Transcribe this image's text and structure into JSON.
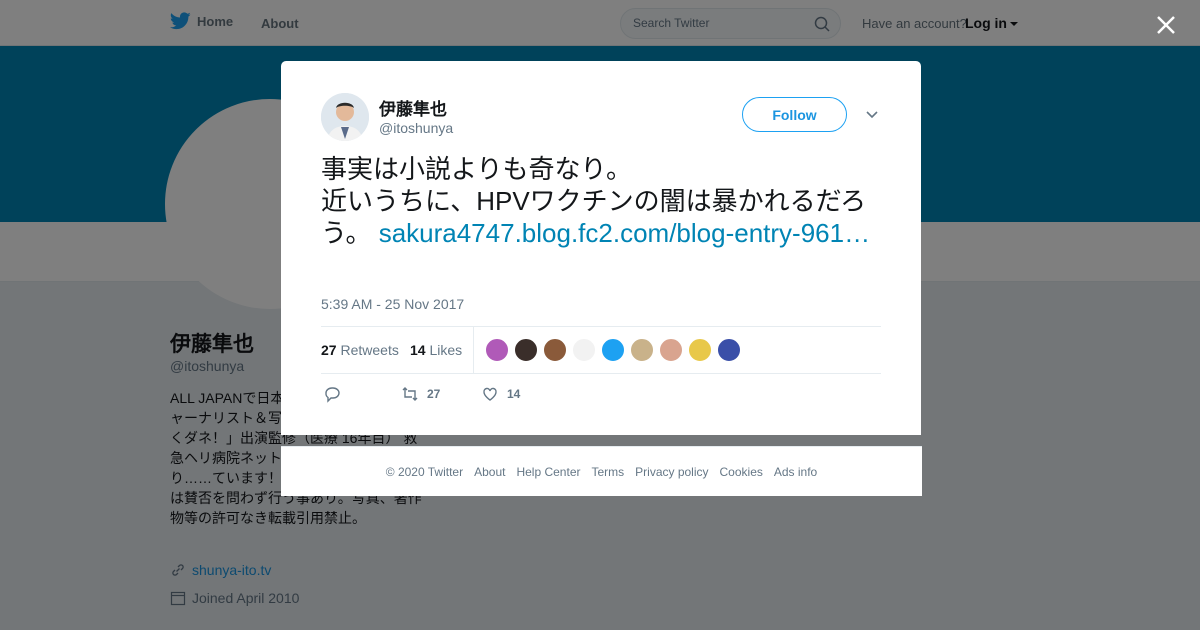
{
  "topnav": {
    "home_label": "Home",
    "about_label": "About",
    "search_placeholder": "Search Twitter",
    "account_prompt": "Have an account?",
    "login_label": "Log in"
  },
  "background_profile": {
    "name": "伊藤隼也",
    "handle": "@itoshunya",
    "bio": "ALL JAPANで日本の医療を考える医療ジャーナリスト＆写真家。フジテレビ「とくダネ！」出演監修（医療 16年目） 救急ヘリ病院ネットワーク（HEM-Net）より……ています！※ 発言は私的呟きでRTは賛否を問わず行う事あり。写真、著作物等の許可なき転載引用禁止。",
    "website": "shunya-ito.tv",
    "joined": "Joined April 2010"
  },
  "tweet": {
    "author_name": "伊藤隼也",
    "author_handle": "@itoshunya",
    "follow_label": "Follow",
    "text_line1": "事実は小説よりも奇なり。",
    "text_line2": "近いうちに、HPVワクチンの闇は暴かれるだろう。",
    "link_text": "sakura4747.blog.fc2.com/blog-entry-961…",
    "timestamp": "5:39 AM - 25 Nov 2017",
    "retweets_count": "27",
    "retweets_label": "Retweets",
    "likes_count": "14",
    "likes_label": "Likes",
    "action_retweet_count": "27",
    "action_like_count": "14",
    "liker_colors": [
      "#b05ab8",
      "#3a2e2a",
      "#8a5a3a",
      "#f2f2f2",
      "#1da1f2",
      "#c9b28a",
      "#d9a48f",
      "#e8c84a",
      "#3a4fa8"
    ]
  },
  "footer": {
    "copyright": "© 2020 Twitter",
    "about": "About",
    "help": "Help Center",
    "terms": "Terms",
    "privacy": "Privacy policy",
    "cookies": "Cookies",
    "ads": "Ads info"
  },
  "colors": {
    "banner": "#0084b4",
    "link": "#0084b4",
    "accent": "#1da1f2"
  }
}
